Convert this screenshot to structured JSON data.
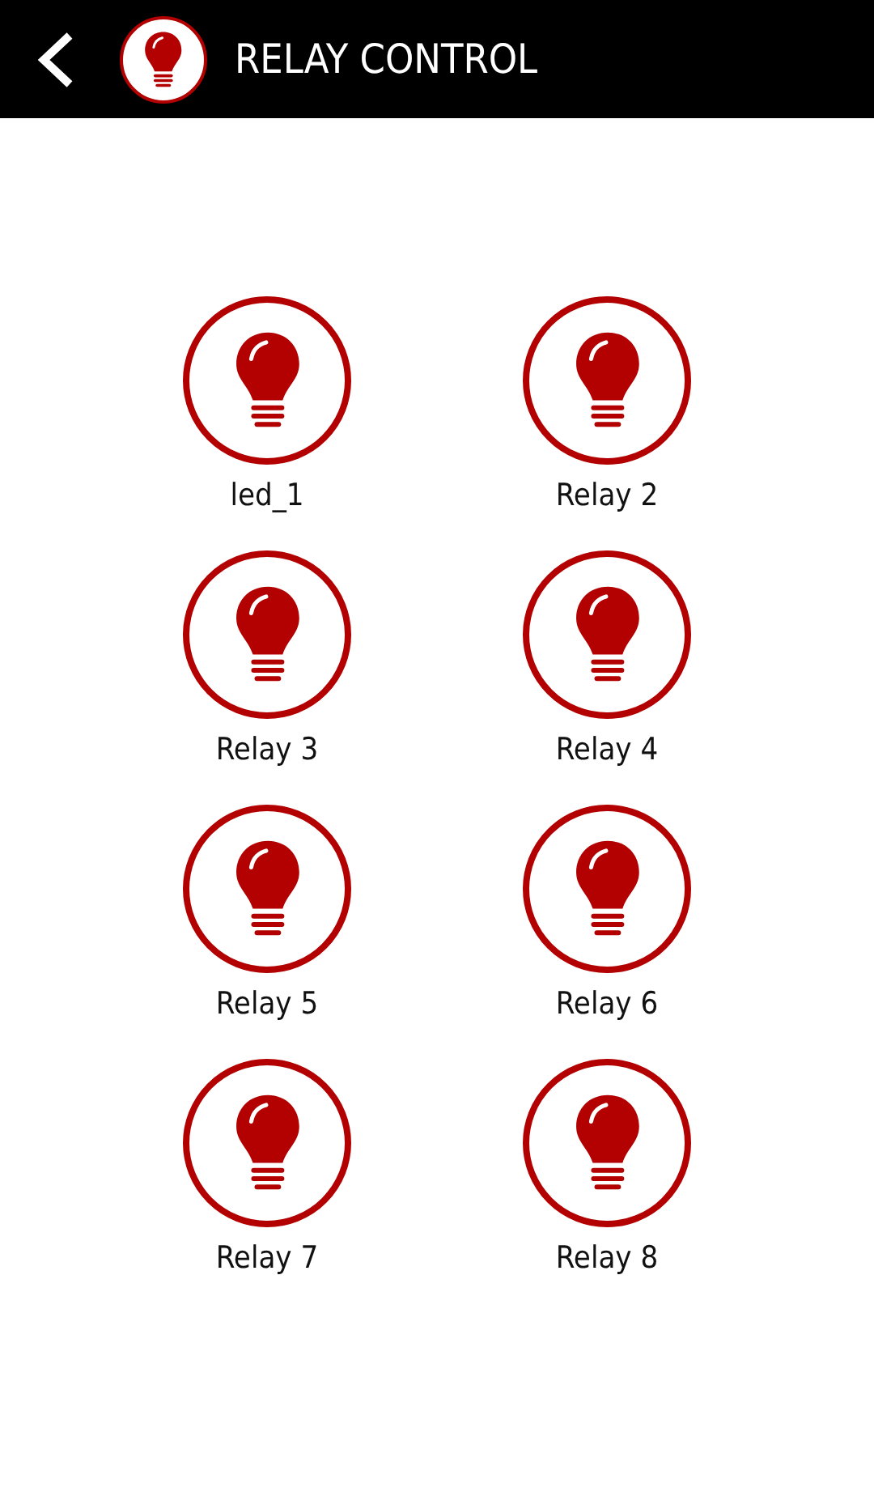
{
  "header": {
    "title": "RELAY CONTROL"
  },
  "relays": [
    {
      "label": "led_1"
    },
    {
      "label": "Relay 2"
    },
    {
      "label": "Relay 3"
    },
    {
      "label": "Relay 4"
    },
    {
      "label": "Relay 5"
    },
    {
      "label": "Relay 6"
    },
    {
      "label": "Relay 7"
    },
    {
      "label": "Relay 8"
    }
  ]
}
